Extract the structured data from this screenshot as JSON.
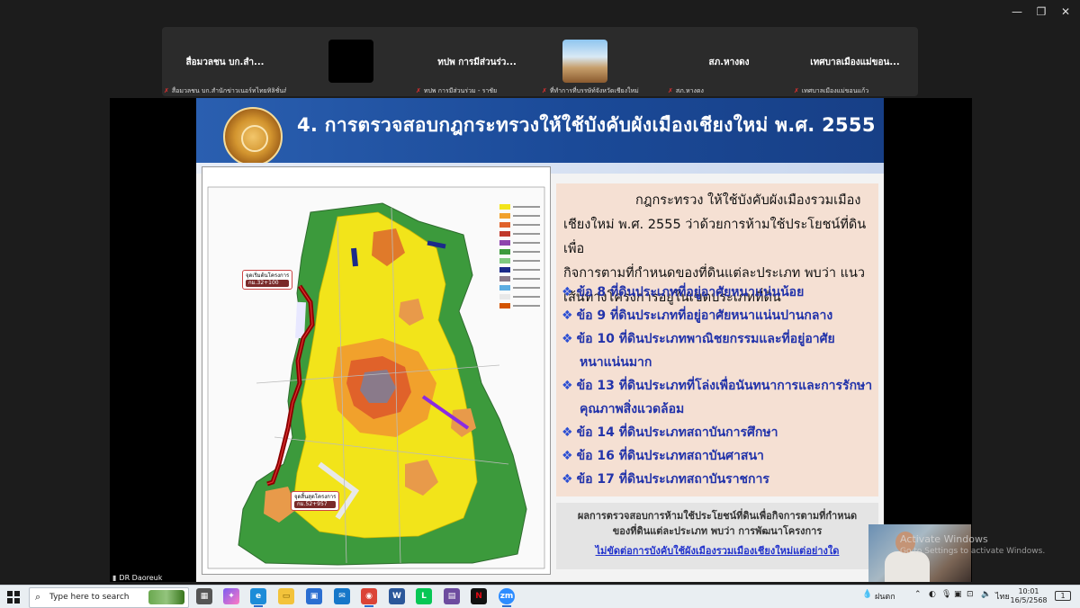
{
  "window": {
    "minimize": "—",
    "restore": "❐",
    "close": "✕"
  },
  "participants": [
    {
      "name": "สื่อมวลชน บก.สำ...",
      "label": "สื่อมวลชน บก.สำนักข่าวเนอร์ทไทยทิลิชั่นส์ -> Co-Host",
      "video": "none"
    },
    {
      "name": "",
      "label": "",
      "video": "black"
    },
    {
      "name": "ทปพ การมีส่วนร่ว...",
      "label": "ทปพ การมีส่วนร่วม - ราชัย",
      "video": "none"
    },
    {
      "name": "",
      "label": "ที่ทำการที่บรรษัท์จังหวัดเชียงใหม่",
      "video": "thumbnail"
    },
    {
      "name": "สภ.หางดง",
      "label": "สภ.หางดง",
      "video": "none"
    },
    {
      "name": "เทศบาลเมืองแม่ขอน...",
      "label": "เทศบาลเมืองแม่ขอนแก้ว",
      "video": "none"
    }
  ],
  "slide": {
    "title": "4. การตรวจสอบกฎกระทรวงให้ใช้บังคับผังเมืองเชียงใหม่ พ.ศ. 2555",
    "map": {
      "start_label": "จุดเริ่มต้นโครงการ",
      "start_km": "กม.32+100",
      "end_label": "จุดสิ้นสุดโครงการ",
      "end_km": "กม.52+957"
    },
    "intro_lines": [
      "กฎกระทรวง ให้ใช้บังคับผังเมืองรวมเมือง",
      "เชียงใหม่ พ.ศ. 2555 ว่าด้วยการห้ามใช้ประโยชน์ที่ดินเพื่อ",
      "กิจการตามที่กำหนดของที่ดินแต่ละประเภท พบว่า แนว",
      "เส้นทางโครงการอยู่ในเขตประเภทที่ดิน"
    ],
    "items": [
      {
        "text": "ข้อ 8 ที่ดินประเภทที่อยู่อาศัยหนาแน่นน้อย",
        "cont": ""
      },
      {
        "text": "ข้อ 9 ที่ดินประเภทที่อยู่อาศัยหนาแน่นปานกลาง",
        "cont": ""
      },
      {
        "text": "ข้อ 10 ที่ดินประเภทพาณิชยกรรมและที่อยู่อาศัย",
        "cont": "หนาแน่นมาก"
      },
      {
        "text": "ข้อ 13 ที่ดินประเภทที่โล่งเพื่อนันทนาการและการรักษา",
        "cont": "คุณภาพสิ่งแวดล้อม"
      },
      {
        "text": "ข้อ 14 ที่ดินประเภทสถาบันการศึกษา",
        "cont": ""
      },
      {
        "text": "ข้อ 16 ที่ดินประเภทสถาบันศาสนา",
        "cont": ""
      },
      {
        "text": "ข้อ 17 ที่ดินประเภทสถาบันราชการ",
        "cont": ""
      }
    ],
    "result_line1": "ผลการตรวจสอบการห้ามใช้ประโยชน์ที่ดินเพื่อกิจการตามที่กำหนด",
    "result_line2": "ของที่ดินแต่ละประเภท พบว่า การพัฒนาโครงการ",
    "result_line3": "ไม่ขัดต่อการบังคับใช้ผังเมืองรวมเมืองเชียงใหม่แต่อย่างใด"
  },
  "speaker": "DR Daoreuk",
  "watermark": {
    "line1": "Activate Windows",
    "line2": "Go to Settings to activate Windows."
  },
  "taskbar": {
    "search_placeholder": "Type here to search",
    "weather": "ฝนตก",
    "lang": "ไทย",
    "time": "10:01",
    "date": "16/5/2568",
    "notif": "1"
  }
}
